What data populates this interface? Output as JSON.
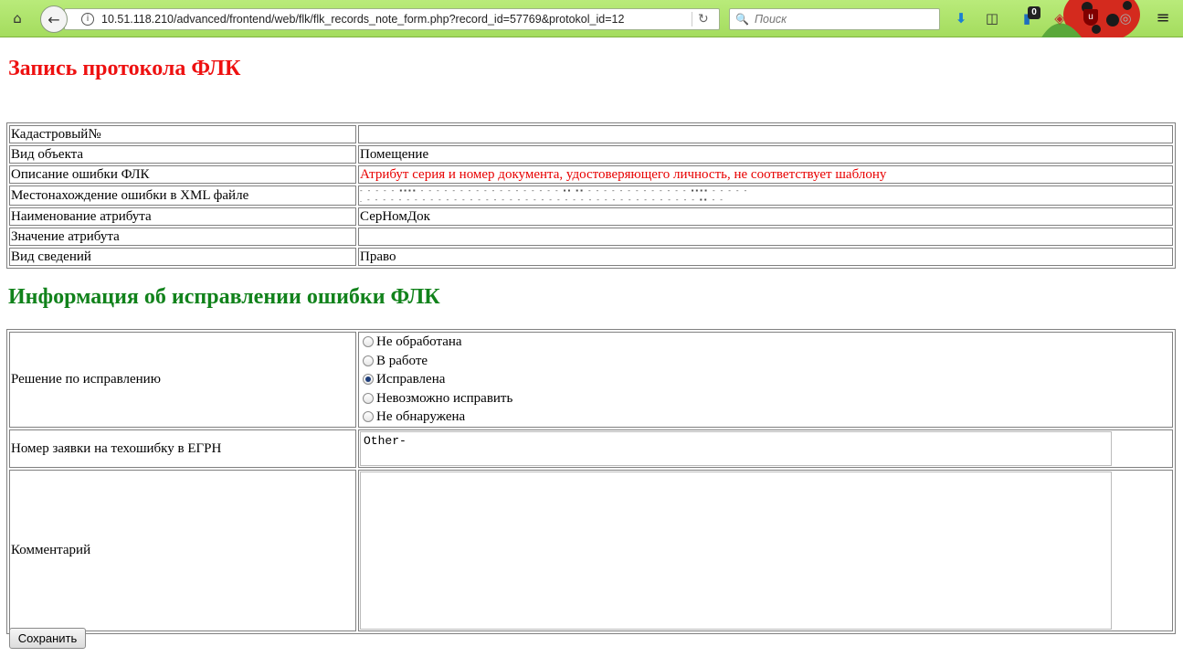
{
  "browser": {
    "url": "10.51.118.210/advanced/frontend/web/flk/flk_records_note_form.php?record_id=57769&protokol_id=12",
    "search_placeholder": "Поиск",
    "counter_badge": "0",
    "ublock_label": "u"
  },
  "page": {
    "title": "Запись протокола ФЛК",
    "section_title": "Информация об исправлении ошибки ФЛК"
  },
  "record": {
    "rows": [
      {
        "label": "Кадастровый№",
        "value": ""
      },
      {
        "label": "Вид объекта",
        "value": "Помещение"
      },
      {
        "label": "Описание ошибки ФЛК",
        "value": "Атрибут серия и номер документа, удостоверяющего личность, не соответствует шаблону"
      },
      {
        "label": "Местонахождение ошибки в XML файле",
        "value": ""
      },
      {
        "label": "Наименование атрибута",
        "value": "СерНомДок"
      },
      {
        "label": "Значение атрибута",
        "value": ""
      },
      {
        "label": "Вид сведений",
        "value": "Право"
      }
    ]
  },
  "fix": {
    "decision_label": "Решение по исправлению",
    "decision_options": [
      "Не обработана",
      "В работе",
      "Исправлена",
      "Невозможно исправить",
      "Не обнаружена"
    ],
    "selected_option": "Исправлена",
    "ticket_label": "Номер заявки на техошибку в ЕГРН",
    "ticket_value": "Other-",
    "comment_label": "Комментарий",
    "comment_value": ""
  },
  "actions": {
    "save_label": "Сохранить"
  },
  "colors": {
    "title": "#ee1111",
    "section_title": "#11821b",
    "error_text": "#e80000",
    "toolbar": "#b9eb7a"
  },
  "icons": [
    "home-icon",
    "back-arrow-icon",
    "info-icon",
    "reload-icon",
    "search-icon",
    "download-icon",
    "window-icon",
    "counter-icon",
    "pocket-icon",
    "ublock-icon",
    "globe-icon",
    "menu-icon"
  ]
}
